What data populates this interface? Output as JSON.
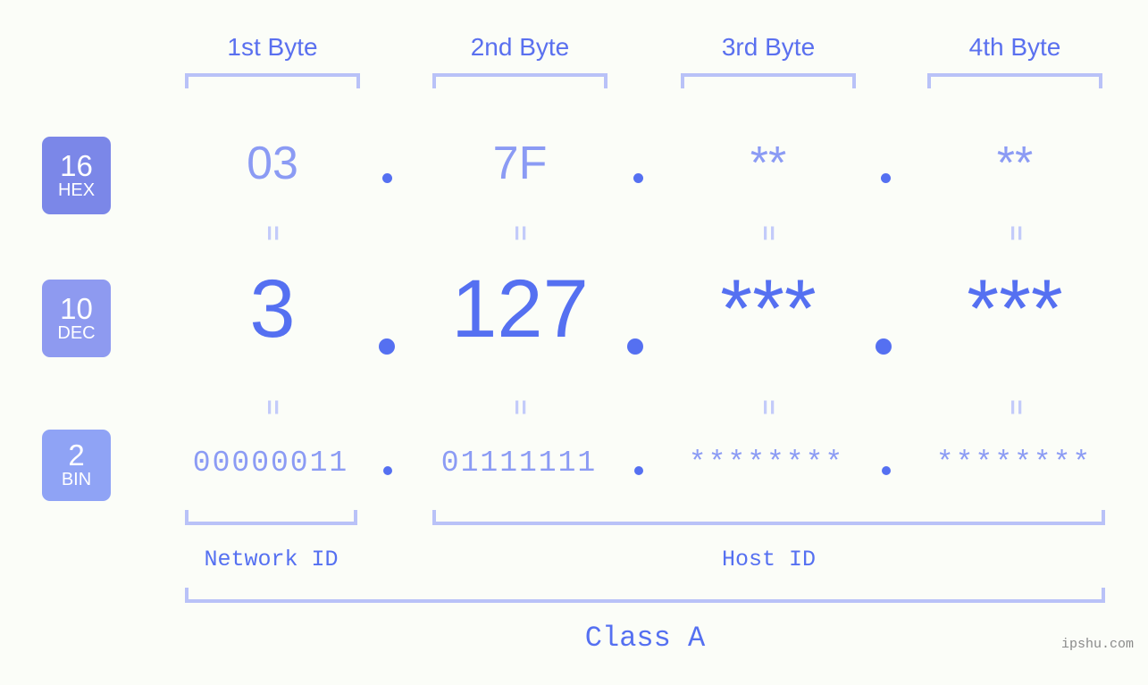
{
  "byte_headers": [
    {
      "label": "1st Byte"
    },
    {
      "label": "2nd Byte"
    },
    {
      "label": "3rd Byte"
    },
    {
      "label": "4th Byte"
    }
  ],
  "bases": [
    {
      "number": "16",
      "name": "HEX",
      "color": "#7b87e8"
    },
    {
      "number": "10",
      "name": "DEC",
      "color": "#8e9af0"
    },
    {
      "number": "2",
      "name": "BIN",
      "color": "#8fa3f5"
    }
  ],
  "rows": {
    "hex": {
      "values": [
        "03",
        "7F",
        "**",
        "**"
      ],
      "separator": "."
    },
    "dec": {
      "values": [
        "3",
        "127",
        "***",
        "***"
      ],
      "separator": "."
    },
    "bin": {
      "values": [
        "00000011",
        "01111111",
        "********",
        "********"
      ],
      "separator": "."
    }
  },
  "equality_marks": {
    "mark": "=",
    "row1": [
      "=",
      "=",
      "=",
      "="
    ],
    "row2": [
      "=",
      "=",
      "=",
      "="
    ]
  },
  "segments": {
    "network_id": "Network ID",
    "host_id": "Host ID"
  },
  "class_label": "Class A",
  "watermark": "ipshu.com",
  "colors": {
    "background": "#fbfdf8",
    "accent_strong": "#5570f1",
    "accent_light": "#8b9bf4",
    "bracket": "#b9c2f8",
    "equals": "#c3cbfa",
    "watermark": "#8a8a8a"
  }
}
